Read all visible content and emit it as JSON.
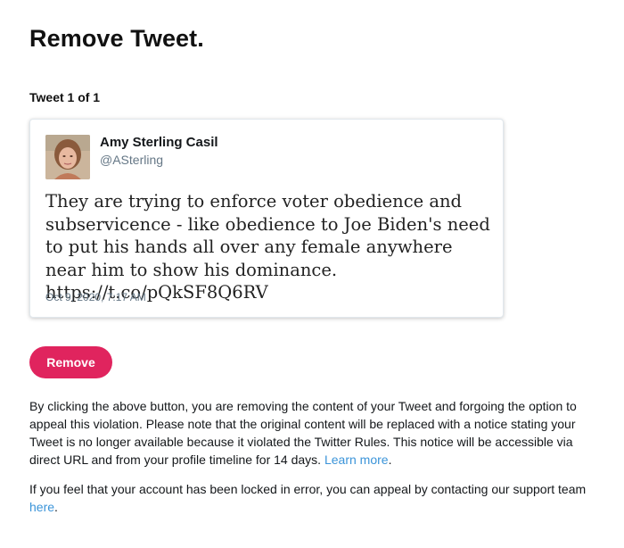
{
  "page": {
    "title": "Remove Tweet.",
    "counter": "Tweet 1 of 1"
  },
  "tweet": {
    "author_name": "Amy Sterling Casil",
    "author_handle": "@ASterling",
    "text": "They are trying to enforce voter obedience and subservicence - like obedience to Joe Biden's need to put his hands all over any female anywhere near him to show his dominance. https://t.co/pQkSF8Q6RV",
    "date": "Oct 9, 2020, 7:17 AM"
  },
  "actions": {
    "remove_label": "Remove"
  },
  "notice": {
    "paragraph1": "By clicking the above button, you are removing the content of your Tweet and forgoing the option to appeal this violation. Please note that the original content will be replaced with a notice stating your Tweet is no longer available because it violated the Twitter Rules. This notice will be accessible via direct URL and from your profile timeline for 14 days.",
    "learn_more": "Learn more",
    "paragraph2": "If you feel that your account has been locked in error, you can appeal by contacting our support team",
    "here": "here"
  },
  "colors": {
    "accent": "#e0245e",
    "link": "#3b94d9",
    "secondary_text": "#657786"
  }
}
